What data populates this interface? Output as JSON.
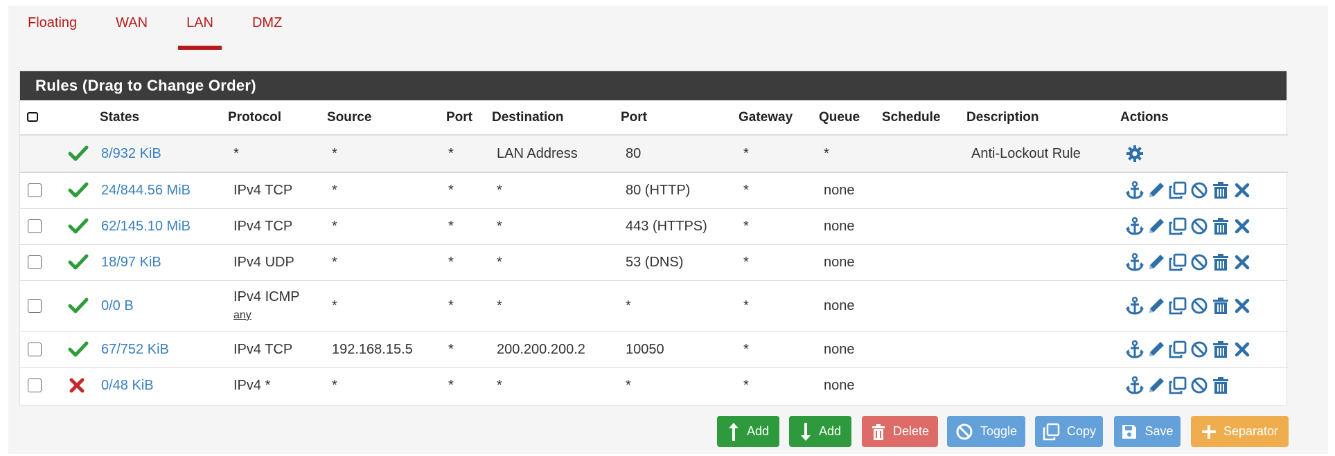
{
  "tabs": [
    {
      "label": "Floating"
    },
    {
      "label": "WAN"
    },
    {
      "label": "LAN",
      "active": true
    },
    {
      "label": "DMZ"
    }
  ],
  "panel": {
    "title": "Rules (Drag to Change Order)"
  },
  "columns": {
    "states": "States",
    "protocol": "Protocol",
    "source": "Source",
    "port": "Port",
    "destination": "Destination",
    "dest_port": "Port",
    "gateway": "Gateway",
    "queue": "Queue",
    "schedule": "Schedule",
    "description": "Description",
    "actions": "Actions"
  },
  "rules": [
    {
      "status": "pass",
      "states": "8/932 KiB",
      "protocol": "*",
      "protocol_sub": "",
      "source": "*",
      "port": "*",
      "destination": "LAN Address",
      "dest_port": "80",
      "gateway": "*",
      "queue": "*",
      "schedule": "",
      "description": "Anti-Lockout Rule",
      "anti_lockout": true
    },
    {
      "status": "pass",
      "states": "24/844.56 MiB",
      "protocol": "IPv4 TCP",
      "protocol_sub": "",
      "source": "*",
      "port": "*",
      "destination": "*",
      "dest_port": "80 (HTTP)",
      "gateway": "*",
      "queue": "none",
      "schedule": "",
      "description": ""
    },
    {
      "status": "pass",
      "states": "62/145.10 MiB",
      "protocol": "IPv4 TCP",
      "protocol_sub": "",
      "source": "*",
      "port": "*",
      "destination": "*",
      "dest_port": "443 (HTTPS)",
      "gateway": "*",
      "queue": "none",
      "schedule": "",
      "description": ""
    },
    {
      "status": "pass",
      "states": "18/97 KiB",
      "protocol": "IPv4 UDP",
      "protocol_sub": "",
      "source": "*",
      "port": "*",
      "destination": "*",
      "dest_port": "53 (DNS)",
      "gateway": "*",
      "queue": "none",
      "schedule": "",
      "description": ""
    },
    {
      "status": "pass",
      "states": "0/0 B",
      "protocol": "IPv4 ICMP",
      "protocol_sub": "any",
      "source": "*",
      "port": "*",
      "destination": "*",
      "dest_port": "*",
      "gateway": "*",
      "queue": "none",
      "schedule": "",
      "description": ""
    },
    {
      "status": "pass",
      "states": "67/752 KiB",
      "protocol": "IPv4 TCP",
      "protocol_sub": "",
      "source": "192.168.15.5",
      "port": "*",
      "destination": "200.200.200.2",
      "dest_port": "10050",
      "gateway": "*",
      "queue": "none",
      "schedule": "",
      "description": ""
    },
    {
      "status": "block",
      "states": "0/48 KiB",
      "protocol": "IPv4 *",
      "protocol_sub": "",
      "source": "*",
      "port": "*",
      "destination": "*",
      "dest_port": "*",
      "gateway": "*",
      "queue": "none",
      "schedule": "",
      "description": "",
      "no_delete_x": true
    }
  ],
  "buttons": {
    "add_top": "Add",
    "add_bottom": "Add",
    "delete": "Delete",
    "toggle": "Toggle",
    "copy": "Copy",
    "save": "Save",
    "separator": "Separator"
  },
  "icons": {
    "pass": "check-icon",
    "block": "times-icon",
    "row_actions": [
      "anchor-icon",
      "pencil-icon",
      "clone-icon",
      "ban-icon",
      "trash-icon",
      "times-icon"
    ],
    "anti_lockout_action": "gear-icon"
  },
  "colors": {
    "tab_active": "#b71c1c",
    "link": "#3a7fc0",
    "pass": "#2e9b3c",
    "block": "#c62828",
    "action_icon": "#2f6fa8",
    "heading_bg": "#3c3c3c"
  }
}
